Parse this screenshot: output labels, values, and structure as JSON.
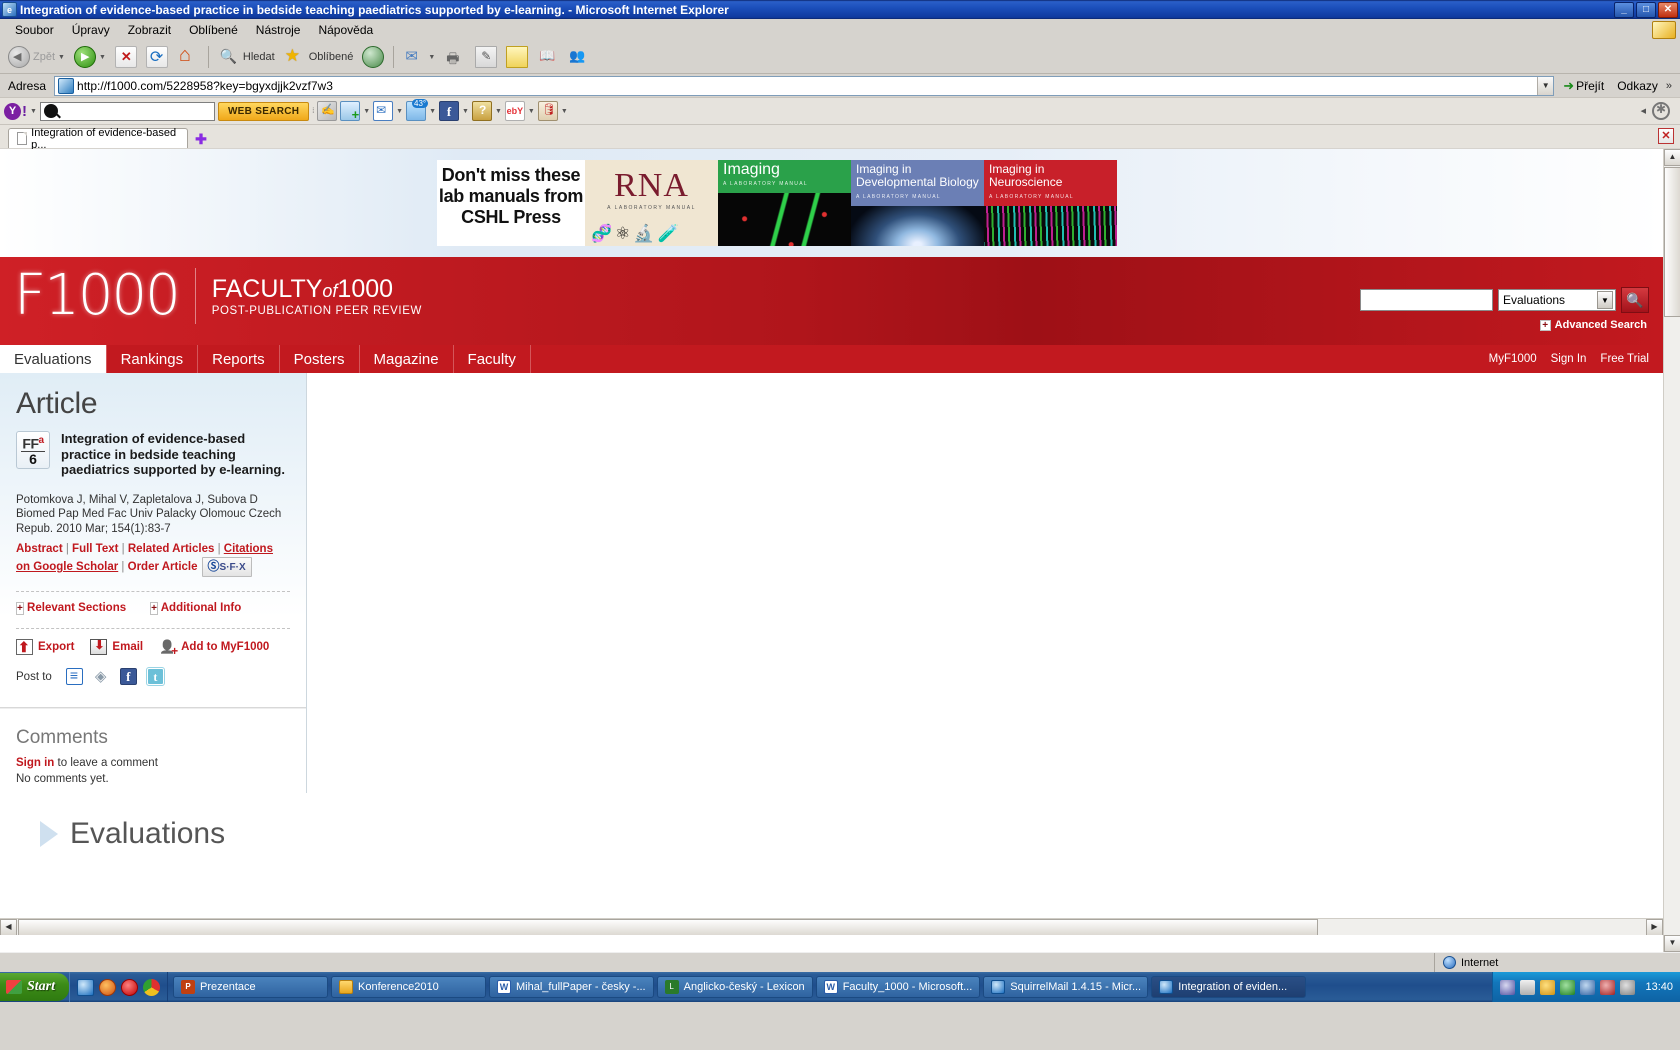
{
  "window": {
    "title": "Integration of evidence-based practice in bedside teaching paediatrics supported by e-learning. - Microsoft Internet Explorer",
    "minimize": "_",
    "maximize": "□",
    "close": "✕"
  },
  "menu": {
    "items": [
      "Soubor",
      "Úpravy",
      "Zobrazit",
      "Oblíbené",
      "Nástroje",
      "Nápověda"
    ]
  },
  "toolbar": {
    "back_label": "Zpět",
    "search_label": "Hledat",
    "favorites_label": "Oblíbené",
    "dropdown_caret": "▼"
  },
  "address": {
    "label": "Adresa",
    "url": "http://f1000.com/5228958?key=bgyxdjjk2vzf7w3",
    "go_label": "Přejít",
    "links_label": "Odkazy",
    "chevron": "»"
  },
  "yahoo_toolbar": {
    "logo": "Y!",
    "search_placeholder": "",
    "search_value": "",
    "web_search_label": "WEB SEARCH",
    "weather_temp": "43°",
    "facebook_glyph": "f",
    "ebay_glyph": "ebY"
  },
  "browser_tab": {
    "label": "Integration of evidence-based p...",
    "new_tab_glyph": "✚",
    "close_glyph": "✕"
  },
  "banner": {
    "headline": "Don't miss these lab manuals from CSHL Press",
    "covers": [
      {
        "title": "RNA",
        "subtitle": "A LABORATORY MANUAL"
      },
      {
        "title": "Imaging",
        "subtitle": "A LABORATORY MANUAL"
      },
      {
        "title": "Imaging in Developmental Biology",
        "subtitle": "A LABORATORY MANUAL"
      },
      {
        "title": "Imaging in Neuroscience",
        "subtitle": "A LABORATORY MANUAL"
      }
    ]
  },
  "site_header": {
    "logo_text": "F1000",
    "tagline_main_pre": "FACULTY",
    "tagline_main_em": "of",
    "tagline_main_post": "1000",
    "tagline_sub": "POST-PUBLICATION PEER REVIEW",
    "search_value": "",
    "scope_selected": "Evaluations",
    "search_icon": "🔍",
    "advanced_search": "Advanced Search",
    "plus_glyph": "✚"
  },
  "nav": {
    "tabs": [
      "Evaluations",
      "Rankings",
      "Reports",
      "Posters",
      "Magazine",
      "Faculty"
    ],
    "active_tab": "Evaluations",
    "right_links": [
      "MyF1000",
      "Sign In",
      "Free Trial"
    ]
  },
  "article": {
    "page_title": "Article",
    "badge_label": "FFa",
    "badge_sup": "a",
    "badge_score": "6",
    "title": "Integration of evidence-based practice in bedside teaching paediatrics supported by e-learning.",
    "authors": "Potomkova J, Mihal V, Zapletalova J, Subova D",
    "citation": "Biomed Pap Med Fac Univ Palacky Olomouc Czech Repub. 2010 Mar; 154(1):83-7",
    "links": [
      "Abstract",
      "Full Text",
      "Related Articles",
      "Citations on Google Scholar",
      "Order Article"
    ],
    "sfx_label": "S·F·X",
    "sfx_mark": "Ⓢ",
    "sections": [
      "Relevant Sections",
      "Additional Info"
    ],
    "actions": [
      "Export",
      "Email",
      "Add to MyF1000"
    ],
    "post_to_label": "Post to",
    "post_to_icons": [
      "citeulike-icon",
      "connotea-icon",
      "facebook-icon",
      "twitter-icon"
    ]
  },
  "comments": {
    "heading": "Comments",
    "signin_link": "Sign in",
    "signin_rest": " to leave a comment",
    "empty": "No comments yet."
  },
  "evaluations": {
    "heading": "Evaluations"
  },
  "status_bar": {
    "left": "",
    "zone": "Internet"
  },
  "taskbar": {
    "start_label": "Start",
    "tasks": [
      {
        "label": "Prezentace",
        "icon": "powerpoint-icon",
        "active": false
      },
      {
        "label": "Konference2010",
        "icon": "folder-icon",
        "active": false
      },
      {
        "label": "Mihal_fullPaper - česky -...",
        "icon": "word-icon",
        "active": false
      },
      {
        "label": "Anglicko-český - Lexicon",
        "icon": "lexicon-icon",
        "active": false
      },
      {
        "label": "Faculty_1000 - Microsoft...",
        "icon": "word-icon",
        "active": false
      },
      {
        "label": "SquirrelMail 1.4.15 - Micr...",
        "icon": "ie-icon",
        "active": false
      },
      {
        "label": "Integration of eviden...",
        "icon": "ie-icon",
        "active": true
      }
    ],
    "clock": "13:40"
  }
}
